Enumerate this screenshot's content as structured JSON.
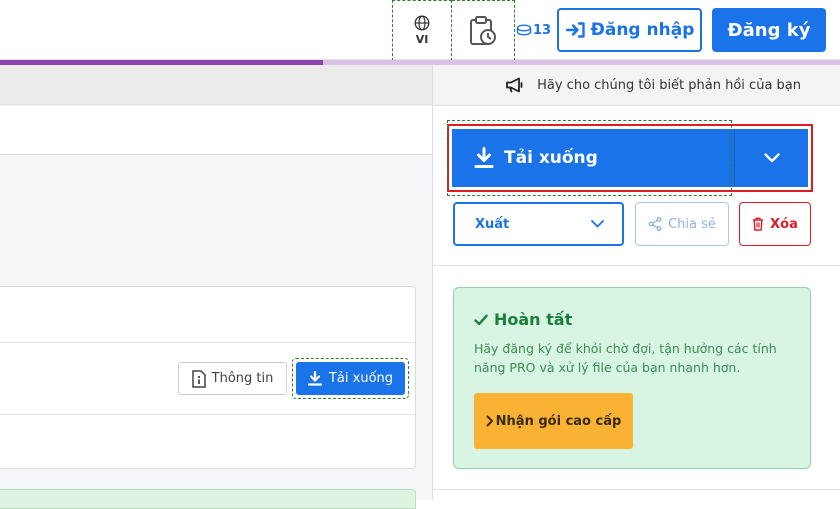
{
  "header": {
    "language_code": "VI",
    "coins": "13",
    "login_label": "Đăng nhập",
    "register_label": "Đăng ký",
    "upload_progress": 0.385
  },
  "feedback": {
    "text": "Hãy cho chúng tôi biết phản hồi của bạn"
  },
  "file_row": {
    "info_label": "Thông tin",
    "download_label": "Tải xuống"
  },
  "actions": {
    "download_label": "Tải xuống",
    "export_label": "Xuất",
    "share_label": "Chia sẻ",
    "delete_label": "Xóa"
  },
  "done": {
    "title": "Hoàn tất",
    "message": "Hãy đăng ký để khỏi chờ đợi, tận hưởng các tính năng PRO và xử lý file của bạn nhanh hơn.",
    "pro_button": "Nhận gói cao cấp"
  },
  "colors": {
    "primary": "#1a73e8",
    "danger": "#e01b24",
    "success_bg": "#d7f5e2",
    "success_text": "#1b7e3c",
    "warning": "#f9b233",
    "progress": "#8e44ad"
  },
  "icons": [
    "globe-icon",
    "clipboard-clock-icon",
    "coins-icon",
    "login-arrow-icon",
    "megaphone-icon",
    "info-icon",
    "download-icon",
    "chevron-down-icon",
    "share-icon",
    "trash-icon",
    "check-icon",
    "chevron-right-icon"
  ]
}
